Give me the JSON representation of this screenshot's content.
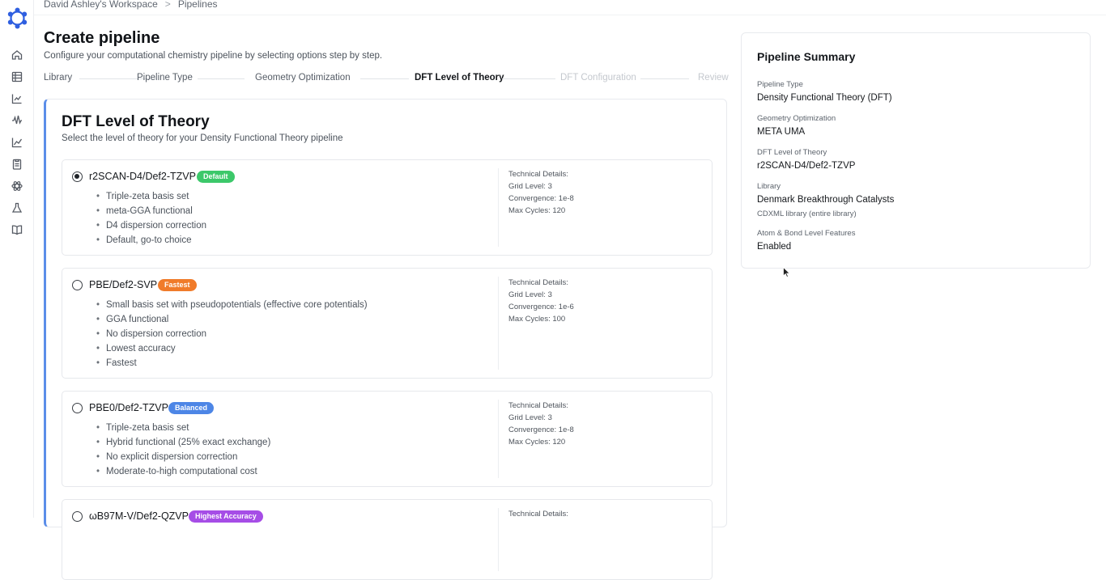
{
  "breadcrumb": {
    "workspace": "David Ashley's Workspace",
    "separator": ">",
    "current": "Pipelines"
  },
  "page": {
    "title": "Create pipeline",
    "subtitle": "Configure your computational chemistry pipeline by selecting options step by step."
  },
  "sidebar": {
    "items": [
      {
        "icon": "home-icon"
      },
      {
        "icon": "table-icon"
      },
      {
        "icon": "chart-icon"
      },
      {
        "icon": "waveform-icon"
      },
      {
        "icon": "line-chart-icon"
      },
      {
        "icon": "clipboard-icon"
      },
      {
        "icon": "atom-icon"
      },
      {
        "icon": "flask-icon"
      },
      {
        "icon": "book-icon"
      }
    ]
  },
  "steps": [
    {
      "label": "Library",
      "state": "done"
    },
    {
      "label": "Pipeline Type",
      "state": "done"
    },
    {
      "label": "Geometry Optimization",
      "state": "done"
    },
    {
      "label": "DFT Level of Theory",
      "state": "current"
    },
    {
      "label": "DFT Configuration",
      "state": "future"
    },
    {
      "label": "Review",
      "state": "future"
    }
  ],
  "card": {
    "title": "DFT Level of Theory",
    "subtitle": "Select the level of theory for your Density Functional Theory pipeline"
  },
  "options": [
    {
      "name": "r2SCAN-D4/Def2-TZVP",
      "badge": "Default",
      "badge_color": "#3cc86a",
      "selected": true,
      "features": [
        "Triple-zeta basis set",
        "meta-GGA functional",
        "D4 dispersion correction",
        "Default, go-to choice"
      ],
      "tech": {
        "heading": "Technical Details:",
        "grid": "Grid Level: 3",
        "convergence": "Convergence: 1e-8",
        "cycles": "Max Cycles: 120"
      }
    },
    {
      "name": "PBE/Def2-SVP",
      "badge": "Fastest",
      "badge_color": "#f07b2a",
      "selected": false,
      "features": [
        "Small basis set with pseudopotentials (effective core potentials)",
        "GGA functional",
        "No dispersion correction",
        "Lowest accuracy",
        "Fastest"
      ],
      "tech": {
        "heading": "Technical Details:",
        "grid": "Grid Level: 3",
        "convergence": "Convergence: 1e-6",
        "cycles": "Max Cycles: 100"
      }
    },
    {
      "name": "PBE0/Def2-TZVP",
      "badge": "Balanced",
      "badge_color": "#4d86e6",
      "selected": false,
      "features": [
        "Triple-zeta basis set",
        "Hybrid functional (25% exact exchange)",
        "No explicit dispersion correction",
        "Moderate-to-high computational cost"
      ],
      "tech": {
        "heading": "Technical Details:",
        "grid": "Grid Level: 3",
        "convergence": "Convergence: 1e-8",
        "cycles": "Max Cycles: 120"
      }
    },
    {
      "name": "ωB97M-V/Def2-QZVP",
      "badge": "Highest Accuracy",
      "badge_color": "#a64de6",
      "selected": false,
      "features": [],
      "tech": {
        "heading": "Technical Details:",
        "grid": "",
        "convergence": "",
        "cycles": ""
      }
    }
  ],
  "summary": {
    "title": "Pipeline Summary",
    "pipeline_type_label": "Pipeline Type",
    "pipeline_type": "Density Functional Theory (DFT)",
    "geometry_label": "Geometry Optimization",
    "geometry": "META UMA",
    "dft_label": "DFT Level of Theory",
    "dft": "r2SCAN-D4/Def2-TZVP",
    "library_label": "Library",
    "library": "Denmark Breakthrough Catalysts",
    "library_note": "CDXML library (entire library)",
    "features_label": "Atom & Bond Level Features",
    "features": "Enabled"
  }
}
